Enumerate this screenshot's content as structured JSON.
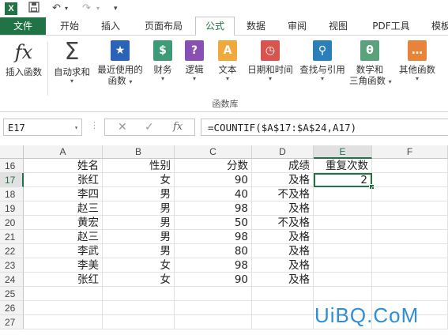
{
  "app": {
    "logo_letter": "X"
  },
  "tabs": [
    "文件",
    "开始",
    "插入",
    "页面布局",
    "公式",
    "数据",
    "审阅",
    "视图",
    "PDF工具",
    "模板"
  ],
  "ribbon": {
    "insert_function": "插入函数",
    "autosum": "自动求和",
    "recent_line1": "最近使用的",
    "recent_line2": "函数",
    "financial": "财务",
    "logical": "逻辑",
    "text": "文本",
    "datetime": "日期和时间",
    "lookup": "查找与引用",
    "math_line1": "数学和",
    "math_line2": "三角函数",
    "other": "其他函数",
    "group_label": "函数库"
  },
  "formula_bar": {
    "name_box": "E17",
    "formula": "=COUNTIF($A$17:$A$24,A17)",
    "fx": "fx"
  },
  "sheet": {
    "columns": [
      "A",
      "B",
      "C",
      "D",
      "E",
      "F"
    ],
    "rows": [
      {
        "n": "16",
        "a": "姓名",
        "b": "性别",
        "c": "分数",
        "d": "成绩",
        "e": "重复次数"
      },
      {
        "n": "17",
        "a": "张红",
        "b": "女",
        "c": "90",
        "d": "及格",
        "e": "2"
      },
      {
        "n": "18",
        "a": "李四",
        "b": "男",
        "c": "40",
        "d": "不及格",
        "e": ""
      },
      {
        "n": "19",
        "a": "赵三",
        "b": "男",
        "c": "98",
        "d": "及格",
        "e": ""
      },
      {
        "n": "20",
        "a": "黄宏",
        "b": "男",
        "c": "50",
        "d": "不及格",
        "e": ""
      },
      {
        "n": "21",
        "a": "赵三",
        "b": "男",
        "c": "98",
        "d": "及格",
        "e": ""
      },
      {
        "n": "22",
        "a": "李武",
        "b": "男",
        "c": "80",
        "d": "及格",
        "e": ""
      },
      {
        "n": "23",
        "a": "李美",
        "b": "女",
        "c": "98",
        "d": "及格",
        "e": ""
      },
      {
        "n": "24",
        "a": "张红",
        "b": "女",
        "c": "90",
        "d": "及格",
        "e": ""
      },
      {
        "n": "25",
        "a": "",
        "b": "",
        "c": "",
        "d": "",
        "e": ""
      },
      {
        "n": "26",
        "a": "",
        "b": "",
        "c": "",
        "d": "",
        "e": ""
      },
      {
        "n": "27",
        "a": "",
        "b": "",
        "c": "",
        "d": "",
        "e": ""
      }
    ]
  },
  "watermark": "UiBQ.CoM",
  "colors": {
    "accent": "#217346",
    "watermark": "#2f8fd6"
  }
}
